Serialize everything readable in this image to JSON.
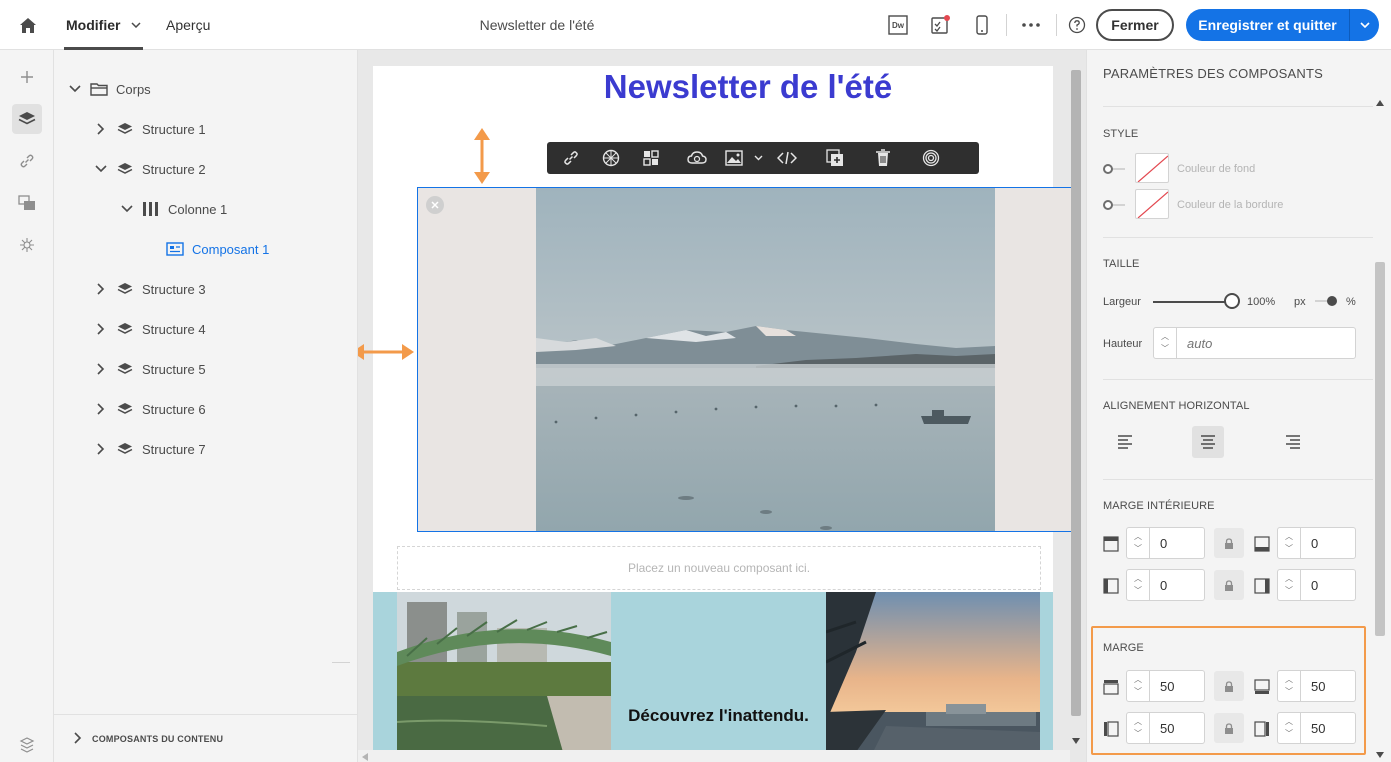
{
  "topbar": {
    "tabs": [
      {
        "label": "Modifier"
      },
      {
        "label": "Aperçu"
      }
    ],
    "document_title": "Newsletter de l'été",
    "close_label": "Fermer",
    "save_label": "Enregistrer et quitter",
    "dw_badge": "Dw"
  },
  "tree": {
    "root": "Corps",
    "items": [
      {
        "label": "Structure 1"
      },
      {
        "label": "Structure 2"
      },
      {
        "label": "Colonne 1"
      },
      {
        "label": "Composant 1"
      },
      {
        "label": "Structure 3"
      },
      {
        "label": "Structure 4"
      },
      {
        "label": "Structure 5"
      },
      {
        "label": "Structure 6"
      },
      {
        "label": "Structure 7"
      }
    ],
    "bottom_section": "COMPOSANTS DU CONTENU"
  },
  "canvas": {
    "newsletter_title": "Newsletter de l'été",
    "dropzone_text": "Placez un nouveau composant ici.",
    "strip_text": "Découvrez l'inattendu."
  },
  "panel": {
    "title": "PARAMÈTRES DES COMPOSANTS",
    "style": {
      "label": "STYLE",
      "bg_color_label": "Couleur de fond",
      "border_color_label": "Couleur de la bordure"
    },
    "size": {
      "label": "TAILLE",
      "width_label": "Largeur",
      "width_value": "100%",
      "width_percent": 100,
      "unit_px": "px",
      "unit_pct": "%",
      "height_label": "Hauteur",
      "height_placeholder": "auto"
    },
    "halign": {
      "label": "ALIGNEMENT HORIZONTAL"
    },
    "padding": {
      "label": "MARGE INTÉRIEURE",
      "top": "0",
      "bottom": "0",
      "left": "0",
      "right": "0"
    },
    "margin": {
      "label": "MARGE",
      "top": "50",
      "bottom": "50",
      "left": "50",
      "right": "50"
    }
  },
  "colors": {
    "accent": "#1473e6",
    "title_blue": "#3b3bd0",
    "highlight_orange": "#f39a4a",
    "strip_bg": "#a9d4dc"
  }
}
